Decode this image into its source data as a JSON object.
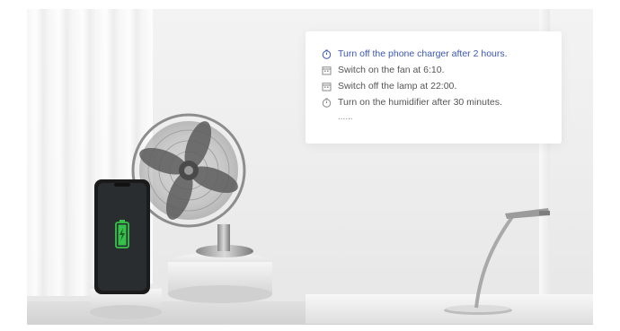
{
  "tasks": [
    {
      "icon": "timer-icon",
      "text": "Turn off the phone charger after 2 hours.",
      "active": true
    },
    {
      "icon": "calendar-icon",
      "text": "Switch on the fan at 6:10.",
      "active": false
    },
    {
      "icon": "calendar-icon",
      "text": "Switch off the lamp at 22:00.",
      "active": false
    },
    {
      "icon": "timer-icon",
      "text": "Turn on the humidifier after 30 minutes.",
      "active": false
    }
  ],
  "more": "......",
  "colors": {
    "accent": "#3a57b7",
    "text": "#555555",
    "battery": "#35c24a"
  }
}
